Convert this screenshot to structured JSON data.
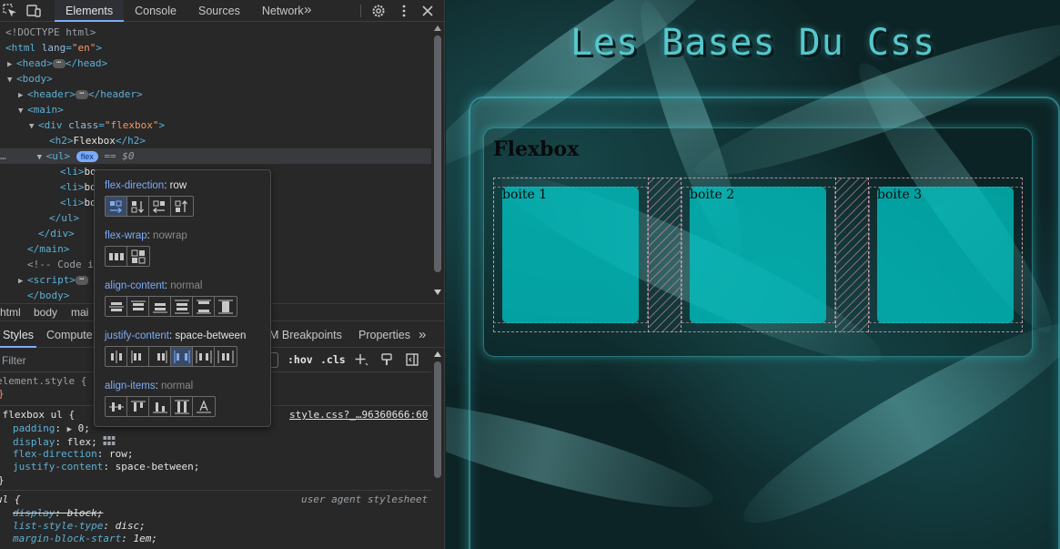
{
  "devtools": {
    "tabs": [
      "Elements",
      "Console",
      "Sources",
      "Network"
    ],
    "more_tabs": "»",
    "elements_tree": {
      "doctype": "<!DOCTYPE html>",
      "html_open": "<html",
      "html_lang_attr": "lang",
      "html_lang_value": "\"en\"",
      "head": "head",
      "body": "body",
      "header": "header",
      "main": "main",
      "div_class_attr": "class",
      "div_class_value": "\"flexbox\"",
      "h2_text": "Flexbox",
      "ul": "ul",
      "flex_badge": "flex",
      "selected_marker": "== $0",
      "li_partial": "bo",
      "comment_partial": "<!-- Code i",
      "script": "script",
      "body_partial": "</body>"
    },
    "breadcrumb": [
      "html",
      "body",
      "mai"
    ],
    "styles_tabs": [
      "Styles",
      "Compute",
      "M Breakpoints",
      "Properties"
    ],
    "filter_placeholder": "Filter",
    "filter_buttons": {
      "hov": ":hov",
      "cls": ".cls"
    },
    "rules": {
      "element_style": "element.style {",
      "close_brace": "}",
      "flexbox_selector": ".flexbox ul {",
      "flexbox_source": "style.css?_…96360666:60",
      "decls": [
        {
          "prop": "padding",
          "val": "0"
        },
        {
          "prop": "display",
          "val": "flex"
        },
        {
          "prop": "flex-direction",
          "val": "row"
        },
        {
          "prop": "justify-content",
          "val": "space-between"
        }
      ],
      "ua_selector": "ul {",
      "ua_source": "user agent stylesheet",
      "ua_decls": [
        {
          "prop": "display",
          "val": "block"
        },
        {
          "prop": "list-style-type",
          "val": "disc"
        },
        {
          "prop": "margin-block-start",
          "val": "1em"
        }
      ]
    },
    "flex_editor": {
      "flex_direction": {
        "key": "flex-direction",
        "val": "row"
      },
      "flex_wrap": {
        "key": "flex-wrap",
        "val": "nowrap"
      },
      "align_content": {
        "key": "align-content",
        "val": "normal"
      },
      "justify_content": {
        "key": "justify-content",
        "val": "space-between"
      },
      "align_items": {
        "key": "align-items",
        "val": "normal"
      }
    }
  },
  "page": {
    "title": "Les Bases Du Css",
    "section_heading": "Flexbox",
    "boxes": [
      "boite 1",
      "boite 2",
      "boite 3"
    ],
    "colors": {
      "accent": "#55c8cc",
      "box": "#00c8c8",
      "background": "#0d2426"
    }
  }
}
